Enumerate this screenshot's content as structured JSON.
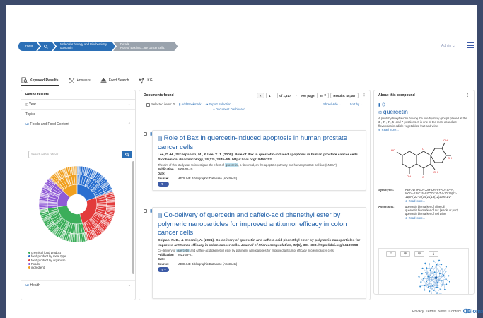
{
  "breadcrumb": {
    "home": "Home",
    "search_icon": "search-icon",
    "item2_line1": "Molecular biology and Biochemistry",
    "item2_line2": "quercetin",
    "item3_line1": "Details",
    "item3_line2": "Role of Bax in q...ate cancer cells."
  },
  "header": {
    "admin": "Admin ⌄",
    "menu_icon": "hamburger-icon"
  },
  "tabs": [
    {
      "label": "Keyword Results",
      "icon": "document-search-icon"
    },
    {
      "label": "Answers",
      "icon": "nodes-icon"
    },
    {
      "label": "Food Search",
      "icon": "food-dish-icon"
    },
    {
      "label": "KGL",
      "icon": "graph-icon"
    }
  ],
  "refine": {
    "title": "Refine results",
    "year": "Year",
    "topics": "Topics",
    "foods": "Foods and Food Content",
    "search_placeholder": "Search within refiner",
    "legend": [
      {
        "label": "chemical food product",
        "color": "#3cae5a"
      },
      {
        "label": "food product by meal type",
        "color": "#2a6fd0"
      },
      {
        "label": "food product by organism",
        "color": "#e23b3b"
      },
      {
        "label": "Foods",
        "color": "#8f5ad6"
      },
      {
        "label": "ingredient",
        "color": "#f0a020"
      }
    ],
    "health": "Health"
  },
  "documents": {
    "title": "Documents found",
    "page": "1",
    "of_pages": "of 1,617",
    "per_page_label": "Per page:",
    "per_page": "25",
    "results": "Results: 40,407",
    "selected": "Selected items: 0",
    "add_bookmark": "Add Bookmark",
    "export": "Export Selection ⌄",
    "dashboard": "Document Dashboard",
    "showhide": "Show/Hide ⌄",
    "sortby": "Sort by ⌄",
    "results_list": [
      {
        "title": "Role of Bax in quercetin-induced apoptosis in human prostate cancer cells.",
        "authors": "Lee, D.-H., Szczepanski, M., & Lee, Y. J. (2008). Role of Bax in quercetin-induced apoptosis in human prostate cancer cells.",
        "journal": "Biochemical Pharmacology, 75",
        "journal_rest": "(12), 2345–55. https://doi.org/18455702",
        "abs_pre": "The aim of this study was to investigate the effect of",
        "abs_hl": "quercetin",
        "abs_post": ", a flavonoid, on the apoptotic pathway in a human prostate cell line (LNCaP).",
        "pub_label": "Publication Date:",
        "pub_date": "2008-06-15",
        "source_label": "Source:",
        "source": "MEDLINE Bibliographic Database (Abstracts)",
        "share": "⇅ ▾"
      },
      {
        "title": "Co-delivery of quercetin and caffeic-acid phenethyl ester by polymeric nanoparticles for improved antitumor efficacy in colon cancer cells.",
        "authors": "Colpan, R. D., & Erdemir, A. (2021). Co-delivery of quercetin and caffeic-acid phenethyl ester by polymeric nanoparticles for improved antitumor efficacy in colon cancer cells.",
        "journal": "Journal of Microencapsulation, 38",
        "journal_rest": "(6), 381–393. https://doi.org/34189998",
        "abs_pre": "Co-delivery of",
        "abs_hl": "quercetin",
        "abs_post": "and caffeic-acid phenethyl ester by polymeric nanoparticles for improved antitumor efficacy in colon cancer cells.",
        "pub_label": "Publication Date:",
        "pub_date": "2021-09-01",
        "source_label": "Source:",
        "source": "MEDLINE Bibliographic Database (Abstracts)",
        "share": "⇅ ▾"
      }
    ]
  },
  "compound": {
    "title": "About this compound",
    "name": "quercetin",
    "description": "A pentahydroxyflavone having the five hydroxy groups placed at the 3-, 3'-, 4'-, 5- and 7-positions. It is one of the most abundant flavonoids in edible vegetables, fruit and wine.",
    "read_more": "⊕ Read more...",
    "synonyms_label": "Synonyms:",
    "synonyms_1": "REFJWTPEDVJJIY-UHFFFAOYSA-N;",
    "synonyms_2": "InChI=1S/C15H10O7/c16-7-4-10(19)12-",
    "synonyms_3": "11(5-7)22-15(14(21)13(12)20)6-1-2-",
    "synonyms_more": "⊕ Read more...",
    "assertions_label": "Assertions:",
    "assertion_1": "quercetin biomarker of olive oil",
    "assertion_2": "quercetin biomarker of nut (whole or part)",
    "assertion_3": "quercetin biomarker of red wine",
    "assertions_more": "⊕ Read more..."
  },
  "footer": {
    "privacy": "Privacy",
    "terms": "Terms",
    "news": "News",
    "contact": "Contact",
    "logo": "Biomax"
  }
}
